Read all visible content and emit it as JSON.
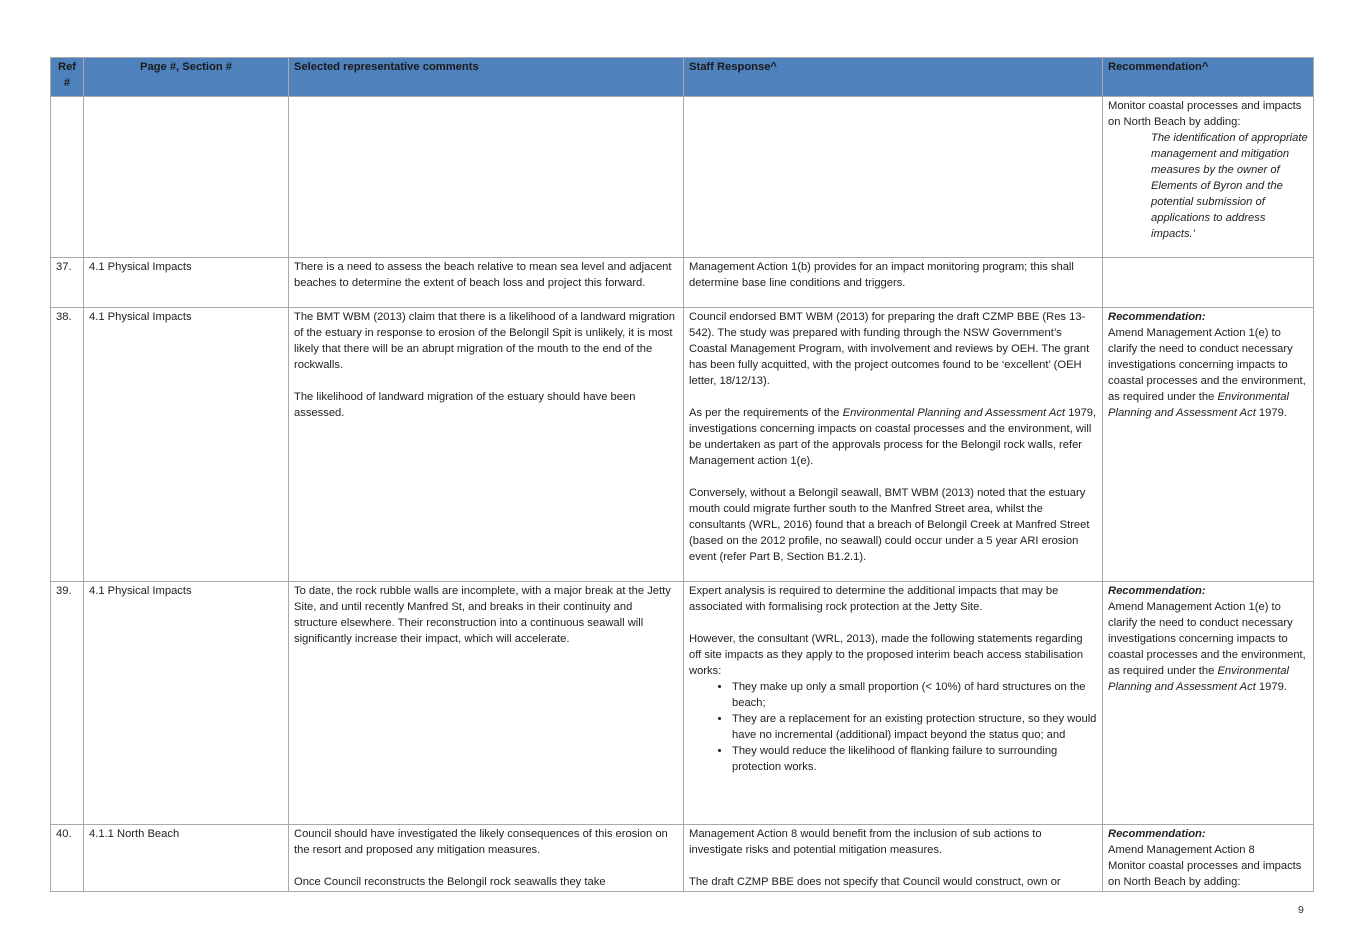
{
  "headers": {
    "ref": "Ref #",
    "page": "Page #, Section #",
    "comments": "Selected representative comments",
    "staff": "Staff Response^",
    "rec": "Recommendation^"
  },
  "row_cont": {
    "rec_intro": "Monitor coastal processes and impacts on North Beach by adding:",
    "rec_quote": "The identification of appropriate management and mitigation measures by the owner of Elements of Byron and the potential submission of applications to address impacts.’"
  },
  "row37": {
    "ref": "37.",
    "page": "4.1 Physical Impacts",
    "comment": "There is a need to assess the beach relative to mean sea level and adjacent beaches to determine the extent of beach loss and project this forward.",
    "staff": "Management Action 1(b) provides for an impact monitoring program; this shall determine base line conditions and triggers."
  },
  "row38": {
    "ref": "38.",
    "page": "4.1 Physical Impacts",
    "comment_1": "The BMT WBM (2013) claim that there is a likelihood of a landward migration of the estuary in response to erosion of the Belongil Spit is unlikely, it is most likely that there will be an abrupt migration of the mouth to the end of the rockwalls.",
    "comment_2": "The likelihood of landward migration of the estuary should have been assessed.",
    "staff_1": "Council endorsed BMT WBM (2013) for preparing the draft CZMP BBE (Res 13-542). The study was prepared with funding through the NSW Government’s Coastal Management Program, with involvement and reviews by OEH. The grant has been fully acquitted, with the project outcomes found to be ‘excellent’ (OEH letter, 18/12/13).",
    "staff_2a": "As per the requirements of the ",
    "staff_2b": "Environmental Planning and Assessment Act",
    "staff_2c": " 1979, investigations concerning impacts on coastal processes and the environment, will be undertaken as part of the approvals process for the Belongil rock walls, refer Management action 1(e).",
    "staff_3": "Conversely, without a Belongil seawall, BMT WBM (2013) noted that the estuary mouth could migrate further south to the Manfred Street area, whilst the consultants (WRL, 2016) found that a breach of Belongil Creek at Manfred Street (based on the 2012 profile, no seawall) could occur under a 5 year ARI erosion event (refer Part B, Section B1.2.1).",
    "rec_label": "Recommendation:",
    "rec_a": "Amend Management Action 1(e) to clarify the need to conduct necessary investigations concerning impacts to coastal processes and the environment, as required under the ",
    "rec_b": "Environmental Planning and Assessment Act",
    "rec_c": " 1979."
  },
  "row39": {
    "ref": "39.",
    "page": "4.1 Physical Impacts",
    "comment": "To date, the rock rubble walls are incomplete, with a major break at the Jetty Site, and until recently Manfred St, and breaks in their continuity and structure elsewhere. Their reconstruction into a continuous seawall will significantly increase their impact, which will accelerate.",
    "staff_1": "Expert analysis is required to determine the additional impacts that may be associated with formalising rock protection at the Jetty Site.",
    "staff_2": "However, the consultant (WRL, 2013), made the following statements regarding off site impacts as they apply to the proposed interim beach access stabilisation works:",
    "bullets": [
      "They make up only a small proportion (< 10%) of hard structures on the beach;",
      "They are a replacement for an existing protection structure, so they would have no incremental (additional) impact beyond the status quo; and",
      "They would reduce the likelihood of flanking failure to surrounding protection works."
    ],
    "rec_label": "Recommendation:",
    "rec_a": "Amend Management Action 1(e) to clarify the need to conduct necessary investigations concerning impacts to coastal processes and the environment, as required under the ",
    "rec_b": "Environmental Planning and Assessment Act",
    "rec_c": " 1979."
  },
  "row40": {
    "ref": "40.",
    "page": "4.1.1 North Beach",
    "comment_1": "Council should have investigated the likely consequences of this erosion on the resort and proposed any mitigation measures.",
    "comment_2": "Once Council reconstructs the Belongil rock seawalls they take",
    "staff_1": "Management Action 8 would benefit from the inclusion of sub actions to investigate risks and potential mitigation measures.",
    "staff_2": "The draft CZMP BBE  does not specify that Council would construct, own or",
    "rec_label": "Recommendation:",
    "rec_1": "Amend Management Action 8",
    "rec_2": "Monitor coastal processes and impacts on North Beach by adding:"
  },
  "page_number": "9"
}
